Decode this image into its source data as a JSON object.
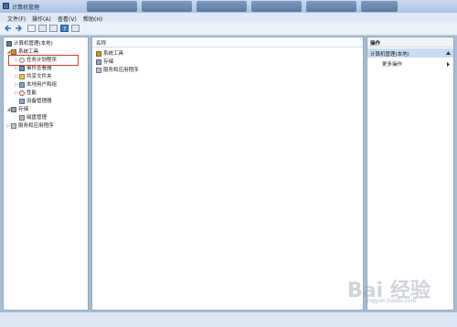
{
  "window": {
    "title": "计算机管理"
  },
  "menu": [
    "文件(F)",
    "操作(A)",
    "查看(V)",
    "帮助(H)"
  ],
  "tree": {
    "root": "计算机管理(本地)",
    "system_tools": "系统工具",
    "task_scheduler": "任务计划程序",
    "event_viewer": "事件查看器",
    "shared_folders": "共享文件夹",
    "local_users": "本地用户和组",
    "performance": "性能",
    "device_manager": "设备管理器",
    "storage": "存储",
    "disk_management": "磁盘管理",
    "services_apps": "服务和应用程序"
  },
  "center": {
    "header": "名称",
    "items": [
      "系统工具",
      "存储",
      "服务和应用程序"
    ]
  },
  "actions": {
    "header": "操作",
    "section": "计算机管理(本地)",
    "more": "更多操作"
  },
  "watermark": {
    "main": "Bai 经验",
    "sub": "jingyan.baidu.com"
  }
}
